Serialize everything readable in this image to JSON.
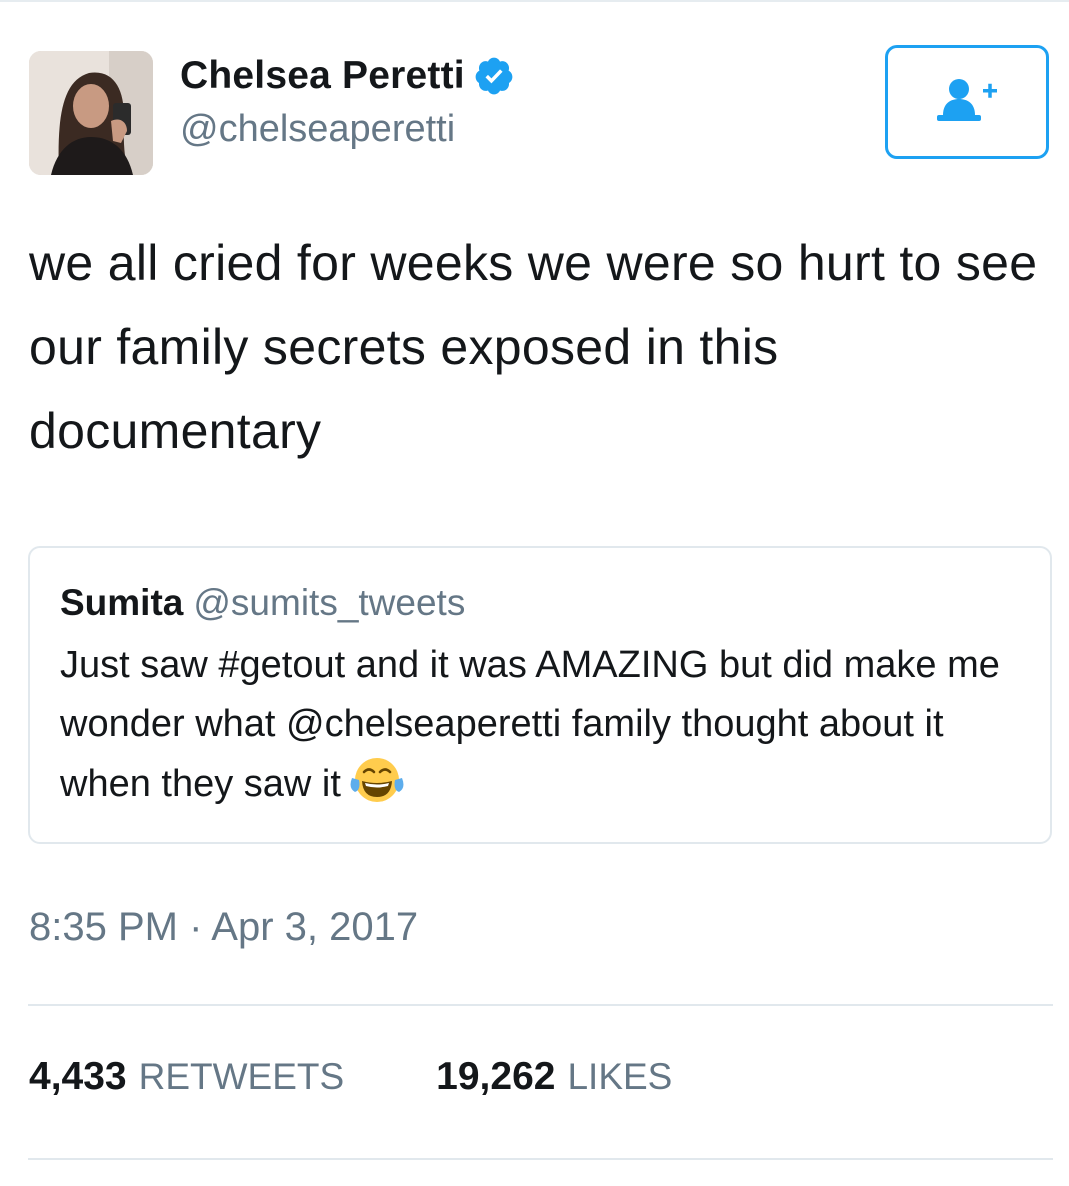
{
  "tweet": {
    "author": {
      "display_name": "Chelsea Peretti",
      "handle": "@chelseaperetti",
      "verified_icon": "verified-badge-icon",
      "avatar_icon": "avatar"
    },
    "follow_button_icon": "add-user-icon",
    "text": "we all cried for weeks we were so hurt to see our family secrets exposed in this documentary",
    "quoted_tweet": {
      "name": "Sumita",
      "handle": "@sumits_tweets",
      "text": "Just saw #getout and it was AMAZING but did make me wonder what @chelseaperetti family thought about it when they saw it",
      "emoji_icon": "face-with-tears-of-joy-icon"
    },
    "timestamp": "8:35 PM · Apr 3, 2017",
    "stats": {
      "retweets_count": "4,433",
      "retweets_label": "RETWEETS",
      "likes_count": "19,262",
      "likes_label": "LIKES"
    }
  },
  "colors": {
    "accent": "#1da1f2",
    "text_primary": "#14171a",
    "text_secondary": "#657786",
    "border": "#e1e8ed"
  }
}
